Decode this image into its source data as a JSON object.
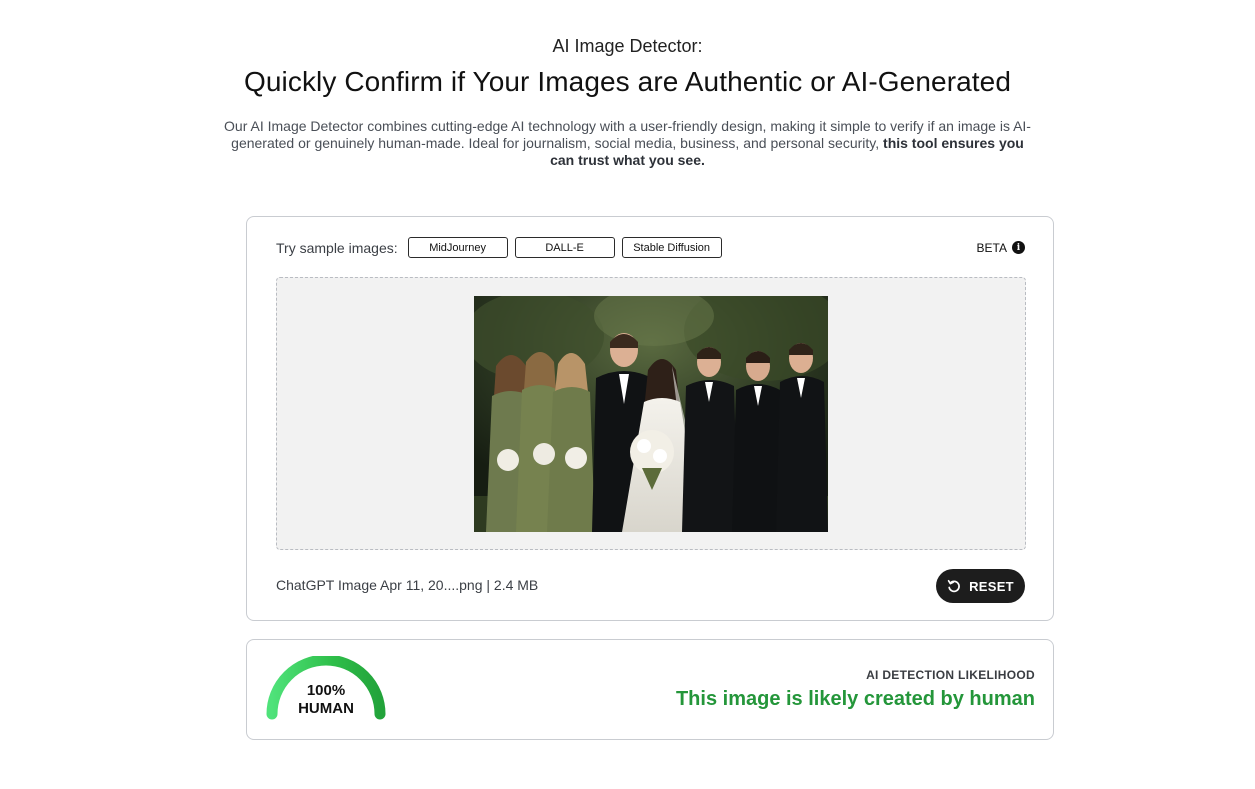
{
  "hero": {
    "eyebrow": "AI Image Detector:",
    "headline": "Quickly Confirm if Your Images are Authentic or AI-Generated",
    "lead_text": "Our AI Image Detector combines cutting-edge AI technology with a user-friendly design, making it simple to verify if an image is AI-generated or genuinely human-made. Ideal for journalism, social media, business, and personal security, ",
    "lead_bold": "this tool ensures you can trust what you see."
  },
  "samples": {
    "label": "Try sample images:",
    "items": [
      "MidJourney",
      "DALL-E",
      "Stable Diffusion"
    ]
  },
  "beta": {
    "label": "BETA",
    "icon": "info-icon"
  },
  "upload": {
    "file_info": "ChatGPT Image Apr 11, 20....png | 2.4 MB",
    "reset_label": "RESET",
    "image_description": "wedding-group-photo"
  },
  "result": {
    "percent_text": "100%",
    "percent_value": 100,
    "classification": "HUMAN",
    "heading": "AI DETECTION LIKELIHOOD",
    "verdict": "This image is likely created by human",
    "accent_color": "#24963a"
  }
}
